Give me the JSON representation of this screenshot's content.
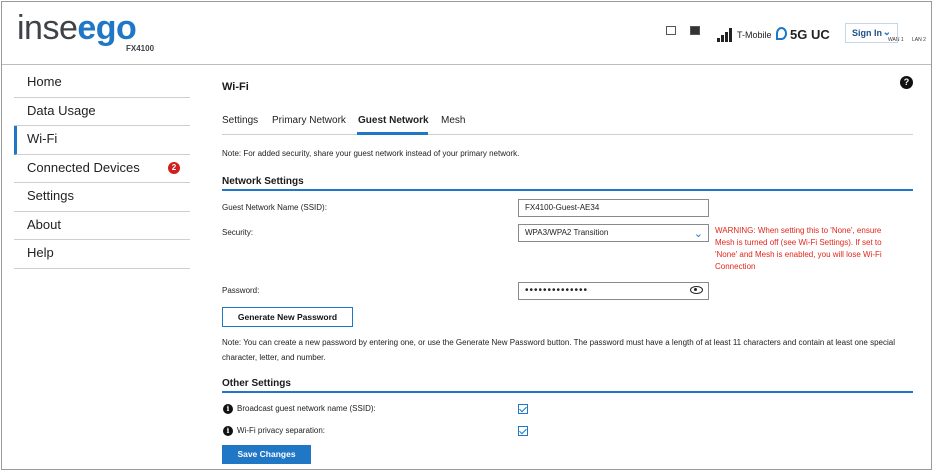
{
  "header": {
    "brand_a": "inse",
    "brand_b": "ego",
    "model": "FX4100",
    "ports": [
      {
        "label": "WAN 1",
        "connected": false
      },
      {
        "label": "LAN 2",
        "connected": true
      }
    ],
    "carrier": "T-Mobile",
    "network": "5G UC",
    "signin_label": "Sign In",
    "signin_icon": "chevron-down-icon"
  },
  "sidebar": {
    "items": [
      {
        "label": "Home"
      },
      {
        "label": "Data Usage"
      },
      {
        "label": "Wi-Fi",
        "active": true
      },
      {
        "label": "Connected Devices",
        "badge": "2"
      },
      {
        "label": "Settings"
      },
      {
        "label": "About"
      },
      {
        "label": "Help"
      }
    ]
  },
  "main": {
    "title": "Wi-Fi",
    "help_icon": "?",
    "tabs": [
      {
        "label": "Settings"
      },
      {
        "label": "Primary Network"
      },
      {
        "label": "Guest Network",
        "active": true
      },
      {
        "label": "Mesh"
      }
    ],
    "note_top": "Note: For added security, share your guest network instead of your primary network.",
    "network_settings": {
      "heading": "Network Settings",
      "ssid_label": "Guest Network Name (SSID):",
      "ssid_value": "FX4100-Guest-AE34",
      "security_label": "Security:",
      "security_value": "WPA3/WPA2 Transition",
      "security_warning": "WARNING: When setting this to 'None', ensure Mesh is turned off (see Wi-Fi Settings). If set to 'None' and Mesh is enabled, you will lose Wi-Fi Connection",
      "password_label": "Password:",
      "password_value": "••••••••••••••",
      "generate_button": "Generate New Password",
      "password_note": "Note: You can create a new password by entering one, or use the Generate New Password button. The password must have a length of at least 11 characters and contain at least one special character, letter, and number."
    },
    "other_settings": {
      "heading": "Other Settings",
      "broadcast_label": "Broadcast guest network name (SSID):",
      "broadcast_checked": true,
      "privacy_label": "Wi-Fi privacy separation:",
      "privacy_checked": true
    },
    "save_button": "Save Changes"
  },
  "colors": {
    "accent": "#1f77c5",
    "warning": "#e2261b",
    "badge": "#d11f1f"
  }
}
